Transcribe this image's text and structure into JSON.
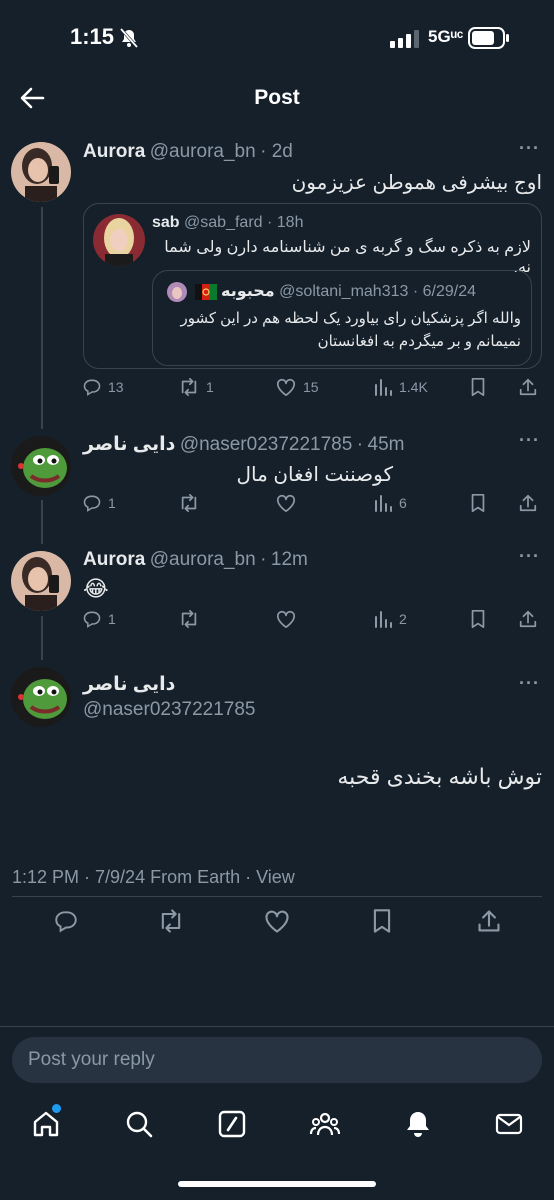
{
  "status": {
    "time": "1:15",
    "network": "5Gᵘᶜ"
  },
  "header": {
    "title": "Post"
  },
  "post1": {
    "name": "Aurora",
    "handle": "@aurora_bn",
    "age": "2d",
    "text": "اوج بیشرفی هموطن عزیزمون",
    "quote": {
      "name": "sab",
      "handle": "@sab_fard",
      "age": "18h",
      "text": "لازم به ذکره سگ و گربه ی من شناسنامه دارن ولی شما نه.",
      "inner": {
        "name": "محبوبه",
        "handle": "@soltani_mah313",
        "age": "6/29/24",
        "text_line1": "والله اگر پزشکیان رای بیاورد یک لحظه هم در این کشور",
        "text_line2": "نمیمانم و بر میگردم به افغانستان"
      }
    },
    "stats": {
      "replies": "13",
      "reposts": "1",
      "likes": "15",
      "views": "1.4K"
    }
  },
  "post2": {
    "name": "دایی ناصر",
    "handle": "@naser0237221785",
    "age": "45m",
    "text": "کوصننت افغان مال",
    "stats": {
      "replies": "1",
      "reposts": "",
      "likes": "",
      "views": "6"
    }
  },
  "post3": {
    "name": "Aurora",
    "handle": "@aurora_bn",
    "age": "12m",
    "text": "😂",
    "stats": {
      "replies": "1",
      "reposts": "",
      "likes": "",
      "views": "2"
    }
  },
  "main": {
    "name": "دایی ناصر",
    "handle": "@naser0237221785",
    "text": "توش باشه بخندی قحبه",
    "meta": "1:12 PM · 7/9/24 From Earth · View"
  },
  "reply": {
    "placeholder": "Post your reply"
  },
  "colors": {
    "background": "#15202b",
    "muted": "#8b98a5",
    "accent": "#1d9bf0"
  },
  "icons": [
    "back-arrow-icon",
    "reply-icon",
    "repost-icon",
    "like-icon",
    "views-icon",
    "bookmark-icon",
    "share-icon",
    "home-icon",
    "search-icon",
    "grok-icon",
    "communities-icon",
    "notifications-icon",
    "messages-icon"
  ]
}
